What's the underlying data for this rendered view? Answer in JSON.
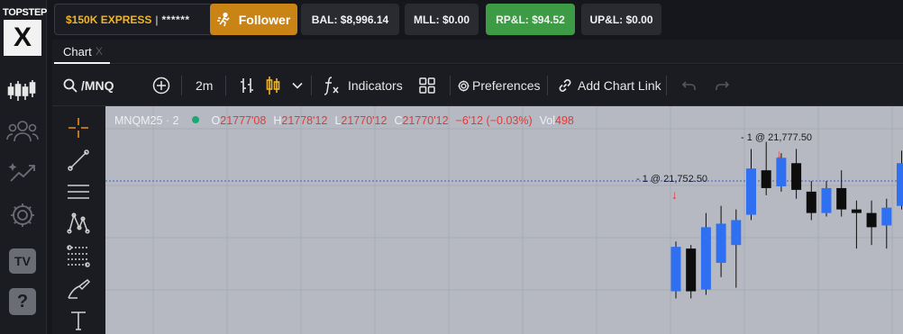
{
  "brand": {
    "top": "TOPSTEP",
    "mark": "X"
  },
  "rail": {
    "icons": [
      "candles-icon",
      "people-icon",
      "trend-stars-icon",
      "gear-icon",
      "tv-icon",
      "help-icon"
    ],
    "tv_label": "TV",
    "help_label": "?"
  },
  "account": {
    "name": "$150K EXPRESS",
    "separator": "|",
    "mask": "******"
  },
  "follower": {
    "label": "Follower"
  },
  "stats": {
    "bal": "BAL: $8,996.14",
    "mll": "MLL: $0.00",
    "rpl": "RP&L: $94.52",
    "upl": "UP&L: $0.00"
  },
  "colors": {
    "accent": "#c98415",
    "positive": "#3d9b45",
    "bull_candle": "#2f6ff2",
    "bear_candle": "#0d0d0d",
    "down_text": "#e53935"
  },
  "tabs": {
    "active": "Chart",
    "close": "X"
  },
  "toolbar": {
    "symbol": "/MNQ",
    "interval": "2m",
    "indicators": "Indicators",
    "preferences": "Preferences",
    "add_chart_link": "Add Chart Link"
  },
  "legend": {
    "symbol": "MNQM25 · 2",
    "o_label": "O",
    "o": "21777'08",
    "h_label": "H",
    "h": "21778'12",
    "l_label": "L",
    "l": "21770'12",
    "c_label": "C",
    "c": "21770'12",
    "change": "−6'12 (−0.03%)",
    "vol_label": "Vol",
    "vol": "498"
  },
  "annotations": [
    {
      "text": "- 1 @ 21,752.50"
    },
    {
      "text": "- 1 @ 21,777.50"
    }
  ],
  "chart_data": {
    "type": "candlestick",
    "candles": [
      {
        "dir": "bull",
        "o": 21740.0,
        "h": 21754.0,
        "l": 21738.0,
        "c": 21752.5
      },
      {
        "dir": "bear",
        "o": 21752.0,
        "h": 21753.0,
        "l": 21738.0,
        "c": 21740.0
      },
      {
        "dir": "bull",
        "o": 21740.5,
        "h": 21762.0,
        "l": 21739.0,
        "c": 21758.0
      },
      {
        "dir": "bull",
        "o": 21748.0,
        "h": 21764.0,
        "l": 21744.0,
        "c": 21759.0
      },
      {
        "dir": "bull",
        "o": 21753.0,
        "h": 21763.0,
        "l": 21741.0,
        "c": 21760.0
      },
      {
        "dir": "bull",
        "o": 21761.5,
        "h": 21780.0,
        "l": 21760.0,
        "c": 21774.5
      },
      {
        "dir": "bear",
        "o": 21774.0,
        "h": 21782.0,
        "l": 21767.0,
        "c": 21769.0
      },
      {
        "dir": "bull",
        "o": 21769.5,
        "h": 21778.8,
        "l": 21768.0,
        "c": 21777.5
      },
      {
        "dir": "bear",
        "o": 21776.0,
        "h": 21780.0,
        "l": 21766.0,
        "c": 21768.5
      },
      {
        "dir": "bear",
        "o": 21768.0,
        "h": 21771.0,
        "l": 21760.0,
        "c": 21762.0
      },
      {
        "dir": "bull",
        "o": 21762.0,
        "h": 21771.0,
        "l": 21761.0,
        "c": 21769.0
      },
      {
        "dir": "bear",
        "o": 21769.0,
        "h": 21774.0,
        "l": 21761.0,
        "c": 21763.0
      },
      {
        "dir": "bear",
        "o": 21763.0,
        "h": 21765.5,
        "l": 21752.0,
        "c": 21762.0
      },
      {
        "dir": "bear",
        "o": 21762.0,
        "h": 21765.5,
        "l": 21753.0,
        "c": 21758.0
      },
      {
        "dir": "bull",
        "o": 21758.5,
        "h": 21766.0,
        "l": 21752.0,
        "c": 21763.5
      },
      {
        "dir": "bull",
        "o": 21764.0,
        "h": 21779.5,
        "l": 21763.0,
        "c": 21776.0
      }
    ],
    "reference_price": 21771.0
  }
}
